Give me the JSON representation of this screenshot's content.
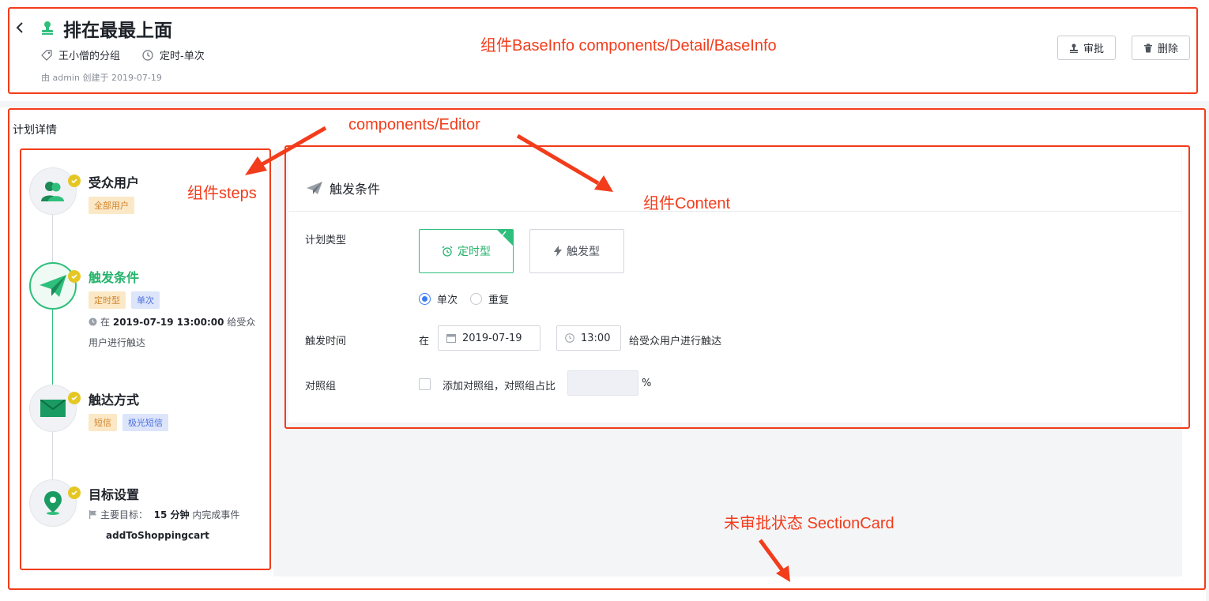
{
  "header": {
    "title": "排在最最上面",
    "group": "王小僧的分组",
    "schedule": "定时-单次",
    "creator": "由 admin 创建于 2019-07-19",
    "approve_label": "审批",
    "delete_label": "删除"
  },
  "section_title": "计划详情",
  "steps": [
    {
      "name": "受众用户",
      "tags": [
        "全部用户"
      ]
    },
    {
      "name": "触发条件",
      "tags": [
        "定时型",
        "单次"
      ],
      "desc_prefix": "在",
      "desc_time": "2019-07-19 13:00:00",
      "desc_suffix": "给受众",
      "desc_line2": "用户进行触达"
    },
    {
      "name": "触达方式",
      "tags": [
        "短信",
        "极光短信"
      ]
    },
    {
      "name": "目标设置",
      "goal_prefix": "主要目标：",
      "goal_value": "15 分钟",
      "goal_suffix": "内完成事件",
      "goal_event": "addToShoppingcart"
    }
  ],
  "content": {
    "title": "触发条件",
    "plan_type_label": "计划类型",
    "type_timed": "定时型",
    "type_trigger": "触发型",
    "radio_once": "单次",
    "radio_repeat": "重复",
    "trigger_time_label": "触发时间",
    "at_label": "在",
    "date_value": "2019-07-19",
    "time_value": "13:00",
    "trigger_suffix": "给受众用户进行触达",
    "control_label": "对照组",
    "control_text": "添加对照组，对照组占比",
    "percent": "%"
  },
  "annotations": {
    "baseinfo": "组件BaseInfo    components/Detail/BaseInfo",
    "editor": "components/Editor",
    "steps": "组件steps",
    "content": "组件Content",
    "sectioncard": "未审批状态   SectionCard"
  },
  "colors": {
    "accent_green": "#2fbf7c",
    "annotation_red": "#f23c1b",
    "tag_orange": "#d0842c",
    "tag_blue": "#4c6fdc",
    "check_yellow": "#e5c722"
  }
}
